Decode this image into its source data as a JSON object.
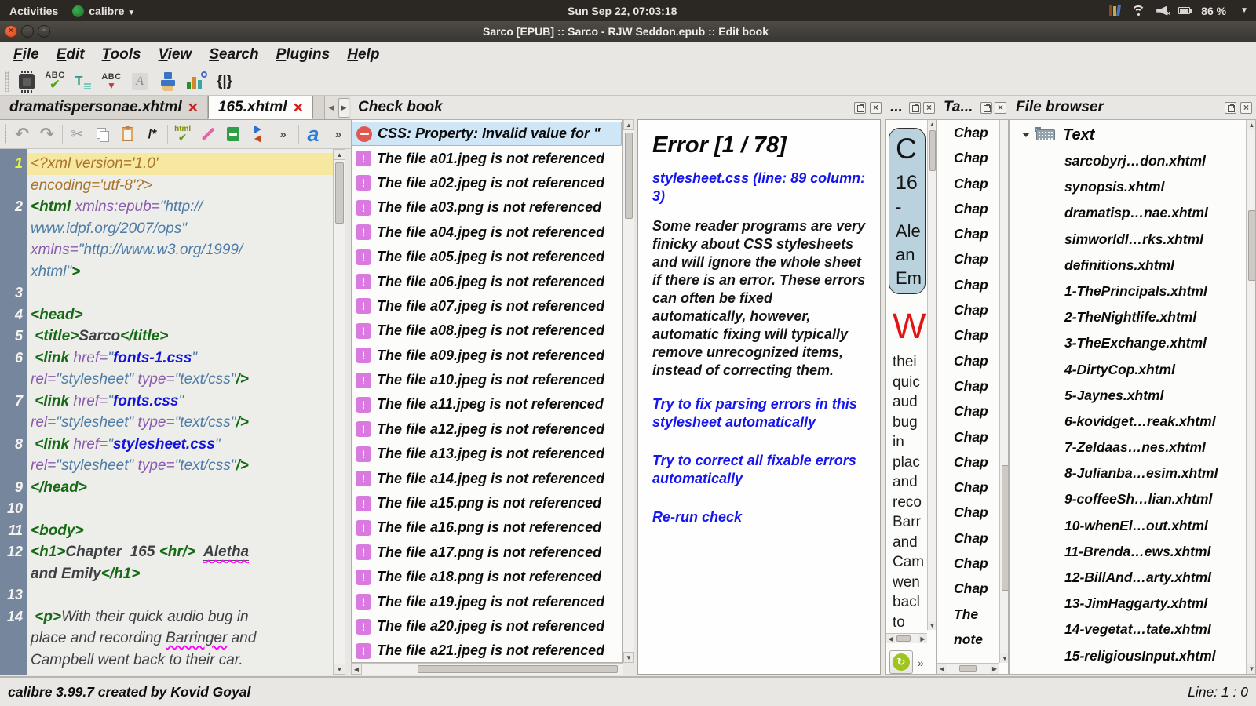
{
  "colors": {
    "selection_blue": "#cfe6f7",
    "error_red": "#e4574f",
    "warning_purple": "#da79e0",
    "link_blue": "#1515ee",
    "tag_green": "#156a15",
    "attr_purple": "#8b5bb0",
    "value_steelblue": "#4d7ca6",
    "css_file_blue": "#1212dd",
    "pi_brown": "#a9742c",
    "current_line_yellow": "#f6e7a1",
    "gutter_slate": "#76869c",
    "close_button_orange": "#d8431a",
    "preview_box_blue": "#b9d2dd",
    "dropcap_red": "#e01515",
    "refresh_green": "#9ec41e"
  },
  "system_bar": {
    "activities_label": "Activities",
    "app_menu_label": "calibre",
    "clock": "Sun Sep 22, 07:03:18",
    "battery_percent": "86 %"
  },
  "title_bar": {
    "title": "Sarco [EPUB] :: Sarco - RJW Seddon.epub :: Edit book"
  },
  "menu_bar": {
    "items": [
      "File",
      "Edit",
      "Tools",
      "View",
      "Search",
      "Plugins",
      "Help"
    ]
  },
  "main_toolbar": {
    "spell_label": "ABC",
    "transform_label": "T",
    "case_label": "ABC",
    "font_label": "A",
    "braces_label": "{|}"
  },
  "tab_bar": {
    "tabs": [
      {
        "label": "dramatispersonae.xhtml",
        "active": false
      },
      {
        "label": "165.xhtml",
        "active": true
      }
    ]
  },
  "editor_toolbar": {
    "undo_glyph": "↶",
    "redo_glyph": "↷",
    "cut_glyph": "✂",
    "comment_label": "/*",
    "html_label": "html",
    "check_glyph": "✔",
    "overflow_glyph": "»",
    "anchor_label": "a"
  },
  "editor": {
    "lines": [
      {
        "num": "1",
        "rows": [
          {
            "hl": true,
            "seg": [
              [
                "pi",
                "<?xml version='1.0'"
              ]
            ]
          },
          {
            "seg": [
              [
                "pi",
                "encoding='utf-8'?>"
              ]
            ]
          }
        ]
      },
      {
        "num": "2",
        "rows": [
          {
            "seg": [
              [
                "tag",
                "<html"
              ],
              [
                "attr",
                " xmlns:epub="
              ],
              [
                "val",
                "\"http://"
              ]
            ]
          },
          {
            "seg": [
              [
                "val",
                "www.idpf.org/2007/ops\""
              ]
            ]
          },
          {
            "seg": [
              [
                "attr",
                "xmlns="
              ],
              [
                "val",
                "\"http://www.w3.org/1999/"
              ]
            ]
          },
          {
            "seg": [
              [
                "val",
                "xhtml\""
              ],
              [
                "tag",
                ">"
              ]
            ]
          }
        ]
      },
      {
        "num": "3",
        "rows": [
          {
            "seg": []
          }
        ]
      },
      {
        "num": "4",
        "rows": [
          {
            "seg": [
              [
                "tag",
                "<head>"
              ]
            ]
          }
        ]
      },
      {
        "num": "5",
        "rows": [
          {
            "seg": [
              [
                "txt",
                " "
              ],
              [
                "tag",
                "<title>"
              ],
              [
                "htxt",
                "Sarco"
              ],
              [
                "tag",
                "</title>"
              ]
            ]
          }
        ]
      },
      {
        "num": "6",
        "rows": [
          {
            "seg": [
              [
                "txt",
                " "
              ],
              [
                "tag",
                "<link"
              ],
              [
                "attr",
                " href="
              ],
              [
                "val",
                "\""
              ],
              [
                "css",
                "fonts-1.css"
              ],
              [
                "val",
                "\""
              ]
            ]
          },
          {
            "seg": [
              [
                "attr",
                "rel="
              ],
              [
                "val",
                "\"stylesheet\""
              ],
              [
                "attr",
                " type="
              ],
              [
                "val",
                "\"text/css\""
              ],
              [
                "tag",
                "/>"
              ]
            ]
          }
        ]
      },
      {
        "num": "7",
        "rows": [
          {
            "seg": [
              [
                "txt",
                " "
              ],
              [
                "tag",
                "<link"
              ],
              [
                "attr",
                " href="
              ],
              [
                "val",
                "\""
              ],
              [
                "css",
                "fonts.css"
              ],
              [
                "val",
                "\""
              ]
            ]
          },
          {
            "seg": [
              [
                "attr",
                "rel="
              ],
              [
                "val",
                "\"stylesheet\""
              ],
              [
                "attr",
                " type="
              ],
              [
                "val",
                "\"text/css\""
              ],
              [
                "tag",
                "/>"
              ]
            ]
          }
        ]
      },
      {
        "num": "8",
        "rows": [
          {
            "seg": [
              [
                "txt",
                " "
              ],
              [
                "tag",
                "<link"
              ],
              [
                "attr",
                " href="
              ],
              [
                "val",
                "\""
              ],
              [
                "css",
                "stylesheet.css"
              ],
              [
                "val",
                "\""
              ]
            ]
          },
          {
            "seg": [
              [
                "attr",
                "rel="
              ],
              [
                "val",
                "\"stylesheet\""
              ],
              [
                "attr",
                " type="
              ],
              [
                "val",
                "\"text/css\""
              ],
              [
                "tag",
                "/>"
              ]
            ]
          }
        ]
      },
      {
        "num": "9",
        "rows": [
          {
            "seg": [
              [
                "tag",
                "</head>"
              ]
            ]
          }
        ]
      },
      {
        "num": "10",
        "rows": [
          {
            "seg": []
          }
        ]
      },
      {
        "num": "11",
        "rows": [
          {
            "seg": [
              [
                "tag",
                "<body>"
              ]
            ]
          }
        ]
      },
      {
        "num": "12",
        "rows": [
          {
            "seg": [
              [
                "tag",
                "<h1>"
              ],
              [
                "htxt",
                "Chapter  165 "
              ],
              [
                "tag",
                "<hr/>"
              ],
              [
                "htxt",
                "  "
              ],
              [
                "sp",
                "Aletha"
              ]
            ]
          },
          {
            "seg": [
              [
                "htxt",
                "and Emily"
              ],
              [
                "tag",
                "</h1>"
              ]
            ]
          }
        ]
      },
      {
        "num": "13",
        "rows": [
          {
            "seg": []
          }
        ]
      },
      {
        "num": "14",
        "rows": [
          {
            "seg": [
              [
                "txt",
                " "
              ],
              [
                "tag",
                "<p>"
              ],
              [
                "txt",
                "With their quick audio bug in"
              ]
            ]
          },
          {
            "seg": [
              [
                "txt",
                "place and recording "
              ],
              [
                "sp2",
                "Barringer"
              ],
              [
                "txt",
                " and"
              ]
            ]
          },
          {
            "seg": [
              [
                "txt",
                "Campbell went back to their car."
              ]
            ]
          }
        ]
      }
    ]
  },
  "check_book": {
    "title": "Check book",
    "items": [
      {
        "icon": "error",
        "selected": true,
        "text": "CSS: Property: Invalid value for \""
      },
      {
        "icon": "warning",
        "text": "The file a01.jpeg is not referenced"
      },
      {
        "icon": "warning",
        "text": "The file a02.jpeg is not referenced"
      },
      {
        "icon": "warning",
        "text": "The file a03.png is not referenced"
      },
      {
        "icon": "warning",
        "text": "The file a04.jpeg is not referenced"
      },
      {
        "icon": "warning",
        "text": "The file a05.jpeg is not referenced"
      },
      {
        "icon": "warning",
        "text": "The file a06.jpeg is not referenced"
      },
      {
        "icon": "warning",
        "text": "The file a07.jpeg is not referenced"
      },
      {
        "icon": "warning",
        "text": "The file a08.jpeg is not referenced"
      },
      {
        "icon": "warning",
        "text": "The file a09.jpeg is not referenced"
      },
      {
        "icon": "warning",
        "text": "The file a10.jpeg is not referenced"
      },
      {
        "icon": "warning",
        "text": "The file a11.jpeg is not referenced"
      },
      {
        "icon": "warning",
        "text": "The file a12.jpeg is not referenced"
      },
      {
        "icon": "warning",
        "text": "The file a13.jpeg is not referenced"
      },
      {
        "icon": "warning",
        "text": "The file a14.jpeg is not referenced"
      },
      {
        "icon": "warning",
        "text": "The file a15.png is not referenced"
      },
      {
        "icon": "warning",
        "text": "The file a16.png is not referenced"
      },
      {
        "icon": "warning",
        "text": "The file a17.png is not referenced"
      },
      {
        "icon": "warning",
        "text": "The file a18.png is not referenced"
      },
      {
        "icon": "warning",
        "text": "The file a19.jpeg is not referenced"
      },
      {
        "icon": "warning",
        "text": "The file a20.jpeg is not referenced"
      },
      {
        "icon": "warning",
        "text": "The file a21.jpeg is not referenced"
      }
    ],
    "detail": {
      "title": "Error [1 / 78]",
      "location_link": "stylesheet.css (line: 89 column: 3)",
      "description": "Some reader programs are very finicky about CSS stylesheets and will ignore the whole sheet if there is an error. These errors can often be fixed automatically, however, automatic fixing will typically remove unrecognized items, instead of correcting them.",
      "links": [
        "Try to fix parsing errors in this stylesheet automatically",
        "Try to correct all fixable errors automatically",
        "Re-run check"
      ]
    }
  },
  "preview": {
    "title": "...",
    "heading_lines": [
      "C",
      "16",
      "-",
      "Ale",
      "an",
      "Em"
    ],
    "dropcap": "W",
    "body_words": [
      "thei",
      "quic",
      "aud",
      "bug",
      "in",
      "plac",
      "and",
      "reco",
      "Barr",
      "and",
      "Cam",
      "wen",
      "bacl",
      "to"
    ]
  },
  "toc": {
    "title": "Ta...",
    "items": [
      "Chap",
      "Chap",
      "Chap",
      "Chap",
      "Chap",
      "Chap",
      "Chap",
      "Chap",
      "Chap",
      "Chap",
      "Chap",
      "Chap",
      "Chap",
      "Chap",
      "Chap",
      "Chap",
      "Chap",
      "Chap",
      "Chap",
      "The",
      "note"
    ]
  },
  "file_browser": {
    "title": "File browser",
    "root_label": "Text",
    "files": [
      "sarcobyrj…don.xhtml",
      "synopsis.xhtml",
      "dramatisp…nae.xhtml",
      "simworldl…rks.xhtml",
      "definitions.xhtml",
      "1-ThePrincipals.xhtml",
      "2-TheNightlife.xhtml",
      "3-TheExchange.xhtml",
      "4-DirtyCop.xhtml",
      "5-Jaynes.xhtml",
      "6-kovidget…reak.xhtml",
      "7-Zeldaas…nes.xhtml",
      "8-Julianba…esim.xhtml",
      "9-coffeeSh…lian.xhtml",
      "10-whenEl…out.xhtml",
      "11-Brenda…ews.xhtml",
      "12-BillAnd…arty.xhtml",
      "13-JimHaggarty.xhtml",
      "14-vegetat…tate.xhtml",
      "15-religiousInput.xhtml"
    ]
  },
  "status_bar": {
    "left": "calibre 3.99.7 created by Kovid Goyal",
    "right": "Line: 1 : 0"
  }
}
